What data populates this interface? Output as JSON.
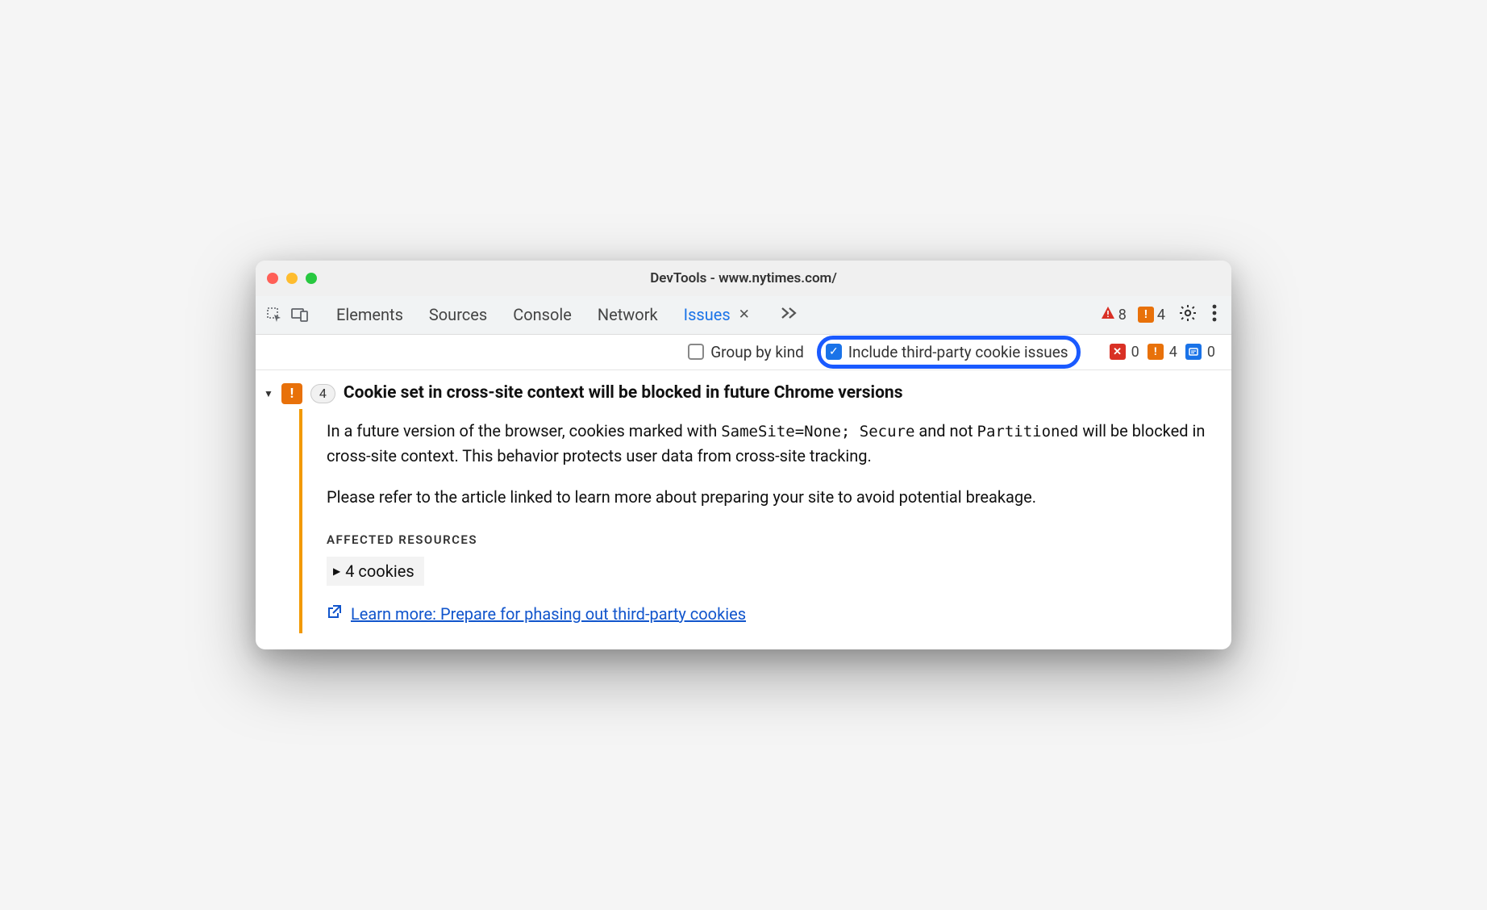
{
  "window": {
    "title": "DevTools - www.nytimes.com/"
  },
  "tabbar": {
    "tabs": {
      "elements": "Elements",
      "sources": "Sources",
      "console": "Console",
      "network": "Network",
      "issues": "Issues"
    },
    "badges": {
      "errors_count": "8",
      "warnings_count": "4"
    }
  },
  "filterbar": {
    "group_by_kind_label": "Group by kind",
    "include_third_party_label": "Include third-party cookie issues",
    "counts": {
      "red": "0",
      "orange": "4",
      "blue": "0"
    }
  },
  "issue": {
    "count": "4",
    "title": "Cookie set in cross-site context will be blocked in future Chrome versions",
    "desc_pre": "In a future version of the browser, cookies marked with ",
    "code1": "SameSite=None; Secure",
    "desc_mid": " and not ",
    "code2": "Partitioned",
    "desc_post": " will be blocked in cross-site context. This behavior protects user data from cross-site tracking.",
    "desc2": "Please refer to the article linked to learn more about preparing your site to avoid potential breakage.",
    "affected_label": "AFFECTED RESOURCES",
    "cookies_label": "4 cookies",
    "learn_more": "Learn more: Prepare for phasing out third-party cookies"
  }
}
